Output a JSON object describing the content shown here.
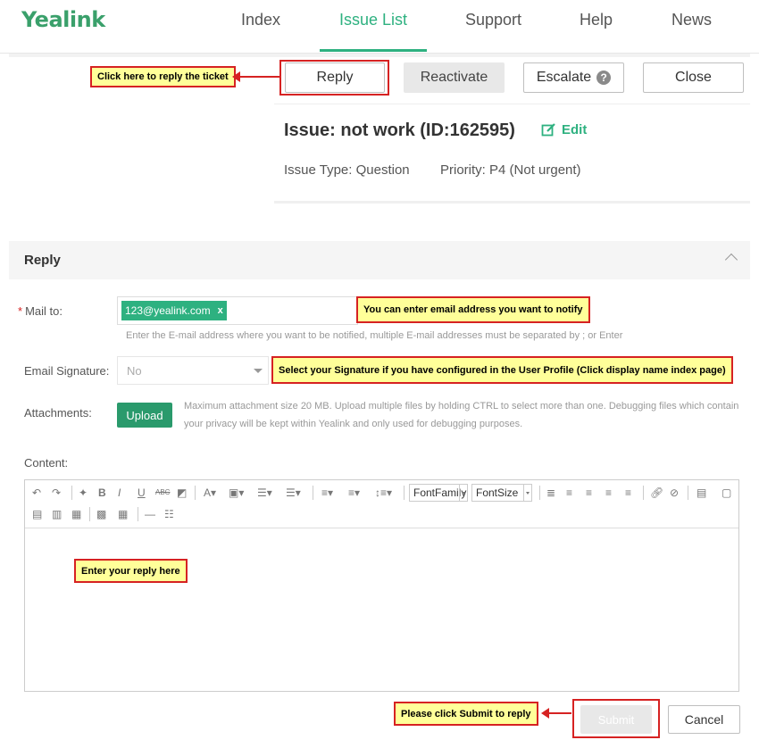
{
  "nav": {
    "logo": "Yealink",
    "items": [
      {
        "label": "Index"
      },
      {
        "label": "Issue List"
      },
      {
        "label": "Support"
      },
      {
        "label": "Help"
      },
      {
        "label": "News"
      }
    ],
    "active": "Issue List"
  },
  "actions": {
    "reply": "Reply",
    "reactivate": "Reactivate",
    "escalate": "Escalate",
    "escalate_help": "?",
    "close": "Close"
  },
  "issue": {
    "title": "Issue: not work (ID:162595)",
    "edit": "Edit",
    "type": "Issue Type: Question",
    "priority": "Priority: P4 (Not urgent)"
  },
  "reply_section": {
    "title": "Reply",
    "mail_to_label": "Mail to:",
    "required_mark": "*",
    "mail_tag": "123@yealink.com",
    "mail_tag_remove": "x",
    "mail_hint": "Enter the E-mail address where you want to be notified, multiple E-mail addresses must be separated by ; or Enter",
    "signature_label": "Email Signature:",
    "signature_value": "No",
    "attachments_label": "Attachments:",
    "upload": "Upload",
    "attachment_hint_1": "Maximum attachment size 20 MB. Upload multiple files by holding CTRL to select more than one. Debugging files which contain",
    "attachment_hint_2": "your privacy will be kept within Yealink and only used for debugging purposes.",
    "content_label": "Content:",
    "font_family": "FontFamily",
    "font_size": "FontSize",
    "submit": "Submit",
    "cancel": "Cancel"
  },
  "annotations": {
    "reply_ticket": "Click here to reply the ticket",
    "email_notify": "You can enter email address you want to notify",
    "signature": "Select your Signature if you have configured in the User Profile (Click display name index page)",
    "enter_reply": "Enter your reply here",
    "click_submit": "Please click Submit to reply"
  },
  "colors": {
    "brand": "#3aa06b",
    "accent": "#2eb180",
    "callout_border": "#d62222",
    "callout_fill": "#ffff99"
  }
}
